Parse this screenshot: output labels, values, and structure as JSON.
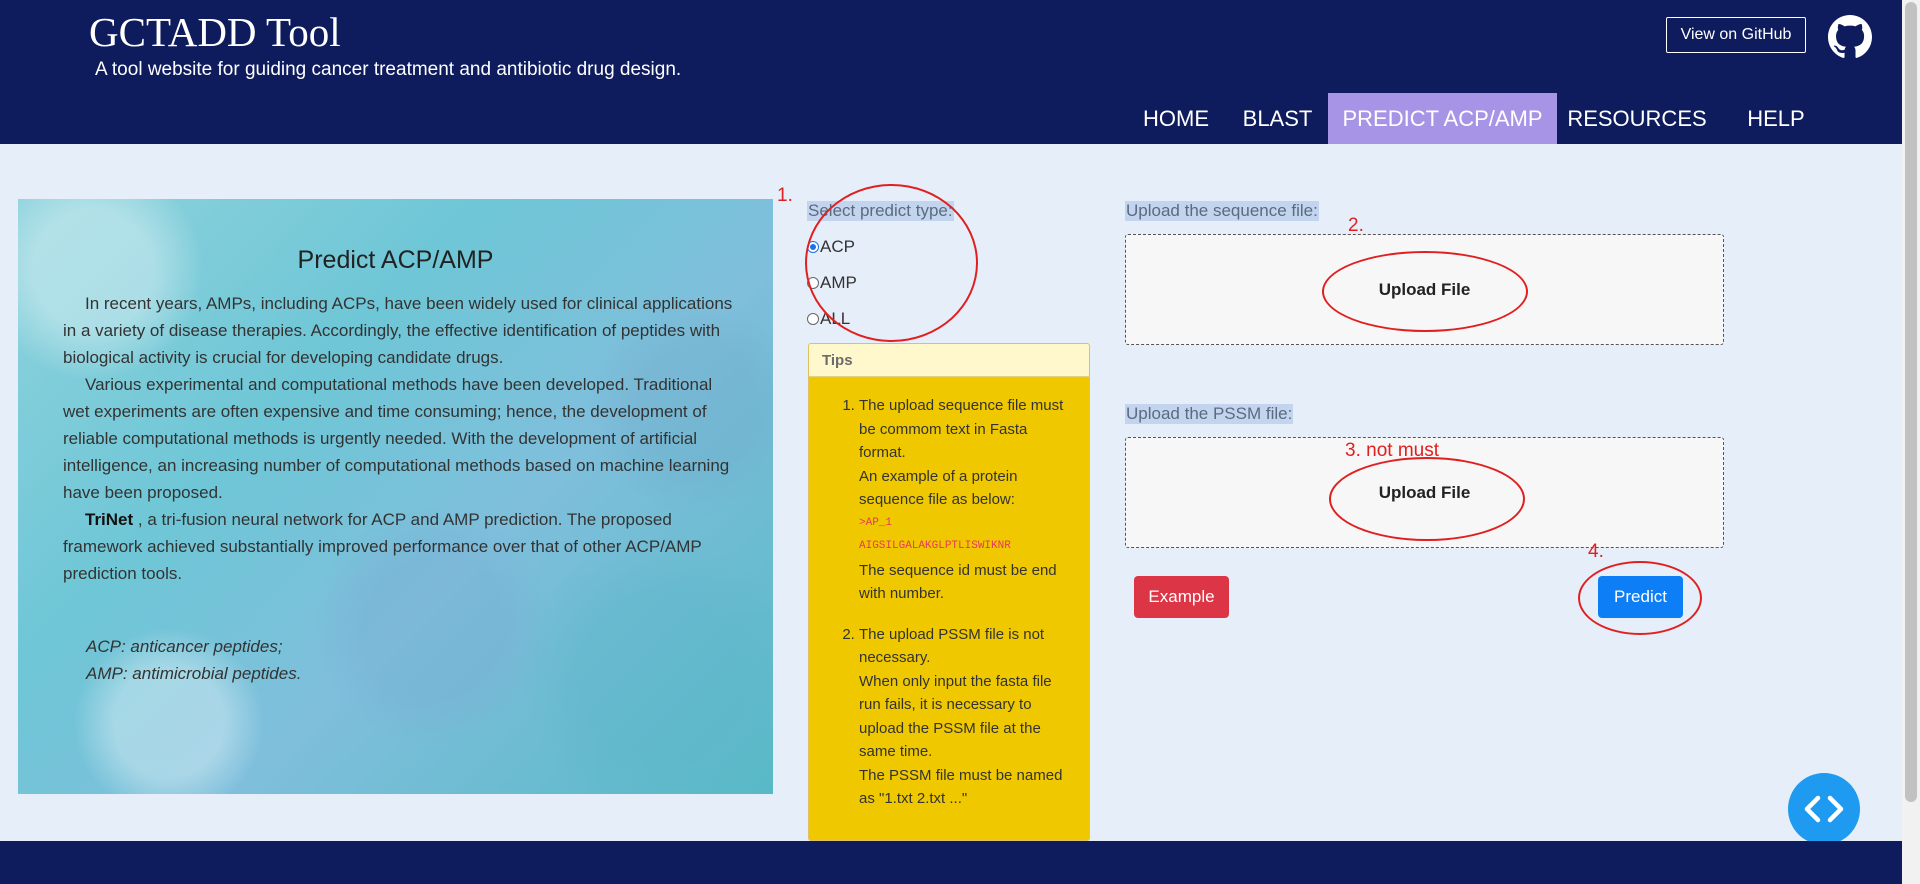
{
  "header": {
    "title": "GCTADD Tool",
    "subtitle": "A tool website for guiding cancer treatment and antibiotic drug design.",
    "github_button": "View on GitHub",
    "github_icon": "github-icon",
    "bg_color": "#0e1b5c"
  },
  "nav": {
    "items": [
      {
        "label": "HOME"
      },
      {
        "label": "BLAST"
      },
      {
        "label": "PREDICT ACP/AMP",
        "active": true
      },
      {
        "label": "RESOURCES"
      },
      {
        "label": "HELP"
      }
    ],
    "active_color": "#a894e6"
  },
  "hero": {
    "title": "Predict ACP/AMP",
    "para1": "In recent years, AMPs, including ACPs, have been widely used for clinical applications in a variety of disease therapies. Accordingly, the effective identification of peptides with biological activity is crucial for developing candidate drugs.",
    "para2": "Various experimental and computational methods have been developed. Traditional wet experiments are often expensive and time consuming; hence, the development of reliable computational methods is urgently needed. With the development of artificial intelligence, an increasing number of computational methods based on machine learning have been proposed.",
    "para3_bold": "TriNet",
    "para3": " , a tri-fusion neural network for ACP and AMP prediction. The proposed framework achieved substantially improved performance over that of other ACP/AMP prediction tools.",
    "abbr_acp": "ACP: anticancer peptides;",
    "abbr_amp": "AMP: antimicrobial peptides."
  },
  "predict_type": {
    "label": "Select predict type:",
    "options": [
      {
        "label": "ACP",
        "checked": true
      },
      {
        "label": "AMP",
        "checked": false
      },
      {
        "label": "ALL",
        "checked": false
      }
    ]
  },
  "tips": {
    "title": "Tips",
    "item1_line1": "The upload sequence file must be commom text in Fasta format.",
    "item1_line2": "An example of a protein sequence file as below:",
    "item1_code1": ">AP_1",
    "item1_code2": "AIGSILGALAKGLPTLISWIKNR",
    "item1_line3": "The sequence id must be end with number.",
    "item2_line1": "The upload PSSM file is not necessary.",
    "item2_line2": "When only input the fasta file run fails, it is necessary to upload the PSSM file at the same time.",
    "item2_line3": "The PSSM file must be named as \"1.txt 2.txt ...\""
  },
  "upload": {
    "sequence_label": "Upload the sequence file:",
    "sequence_button": "Upload File",
    "pssm_label": "Upload the PSSM file:",
    "pssm_button": "Upload File"
  },
  "actions": {
    "example": "Example",
    "predict": "Predict",
    "example_color": "#dc3545",
    "predict_color": "#0d7ef5"
  },
  "annotations": {
    "n1": "1.",
    "n2": "2.",
    "n3": "3. not must",
    "n4": "4.",
    "color": "#e02020"
  },
  "float_button": {
    "icon": "code-icon"
  }
}
